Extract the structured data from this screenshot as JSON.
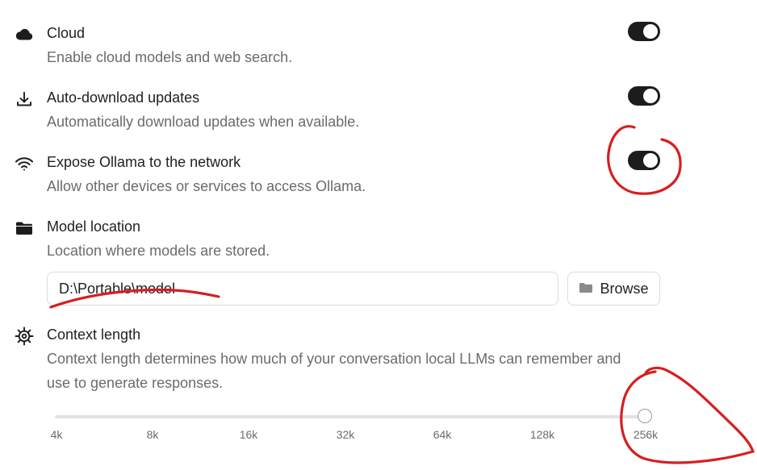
{
  "settings": {
    "cloud": {
      "title": "Cloud",
      "description": "Enable cloud models and web search.",
      "icon": "cloud-icon",
      "enabled": true
    },
    "auto_download": {
      "title": "Auto-download updates",
      "description": "Automatically download updates when available.",
      "icon": "download-icon",
      "enabled": true
    },
    "expose_network": {
      "title": "Expose Ollama to the network",
      "description": "Allow other devices or services to access Ollama.",
      "icon": "wifi-icon",
      "enabled": true
    },
    "model_location": {
      "title": "Model location",
      "description": "Location where models are stored.",
      "icon": "folder-icon",
      "path": "D:\\Portable\\model",
      "browse_label": "Browse",
      "browse_icon": "folder-icon"
    },
    "context_length": {
      "title": "Context length",
      "description_line1": "Context length determines how much of your conversation local LLMs can remember and",
      "description_line2": "use to generate responses.",
      "icon": "gear-icon",
      "ticks": [
        "4k",
        "8k",
        "16k",
        "32k",
        "64k",
        "128k",
        "256k"
      ],
      "selected": "256k"
    }
  },
  "colors": {
    "toggle_on": "#1c1c1c",
    "annotation": "#d61f1f",
    "muted_text": "#6b6b6b"
  }
}
